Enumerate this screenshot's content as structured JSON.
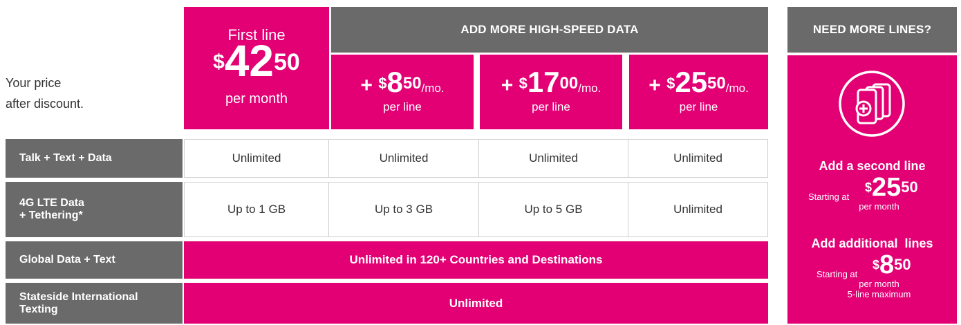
{
  "intro": {
    "line1": "Your price",
    "line2": "after discount."
  },
  "first_line": {
    "label": "First line",
    "dollar": "$",
    "whole": "42",
    "cents": "50",
    "per": "per month"
  },
  "header_add_data": "ADD MORE HIGH-SPEED DATA",
  "addons": [
    {
      "prefix": "+ ",
      "dollar": "$",
      "whole": "8",
      "cents": "50",
      "unit": "/mo.",
      "per": "per line"
    },
    {
      "prefix": "+ ",
      "dollar": "$",
      "whole": "17",
      "cents": "00",
      "unit": "/mo.",
      "per": "per line"
    },
    {
      "prefix": "+ ",
      "dollar": "$",
      "whole": "25",
      "cents": "50",
      "unit": "/mo.",
      "per": "per line"
    }
  ],
  "rows": [
    {
      "label": "Talk + Text + Data",
      "cells": [
        "Unlimited",
        "Unlimited",
        "Unlimited",
        "Unlimited"
      ]
    },
    {
      "label_line1": "4G LTE Data",
      "label_line2": "+ Tethering*",
      "cells": [
        "Up to 1 GB",
        "Up to 3 GB",
        "Up to 5 GB",
        "Unlimited"
      ]
    },
    {
      "label": "Global Data + Text",
      "banner": "Unlimited in 120+ Countries and Destinations"
    },
    {
      "label_line1": "Stateside International",
      "label_line2": "Texting",
      "banner": "Unlimited"
    }
  ],
  "sidebar": {
    "header": "NEED MORE LINES?",
    "icon": "multiple-phones-add-icon",
    "second": {
      "title": "Add a second line",
      "starting": "Starting at",
      "dollar": "$",
      "whole": "25",
      "cents": "50",
      "per": "per month"
    },
    "additional": {
      "title": "Add additional  lines",
      "starting": "Starting at",
      "dollar": "$",
      "whole": "8",
      "cents": "50",
      "per": "per month",
      "max": "5-line maximum"
    }
  },
  "colors": {
    "magenta": "#e20074",
    "gray": "#6b6a6a"
  }
}
